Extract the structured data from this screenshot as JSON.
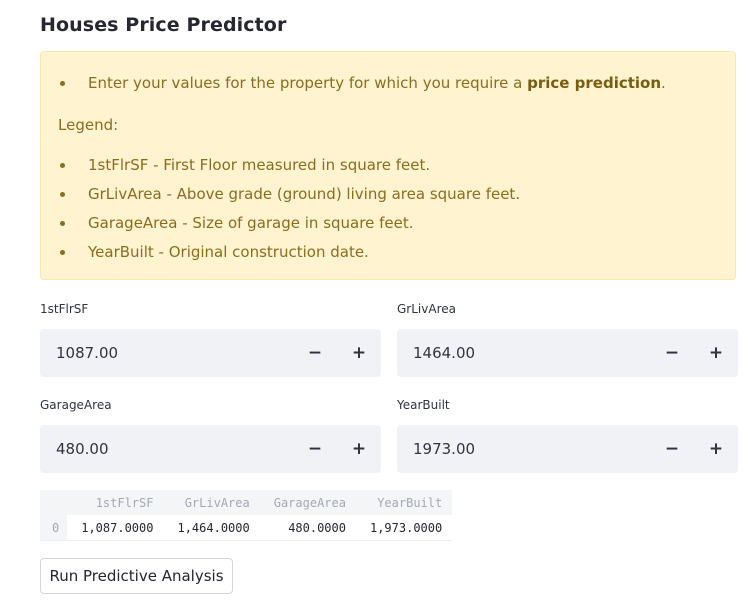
{
  "title": "Houses Price Predictor",
  "info": {
    "intro_prefix": "Enter your values for the property for which you require a ",
    "intro_bold": "price prediction",
    "intro_suffix": ".",
    "legend_label": "Legend:",
    "legend_items": [
      "1stFlrSF - First Floor measured in square feet.",
      "GrLivArea - Above grade (ground) living area square feet.",
      "GarageArea - Size of garage in square feet.",
      "YearBuilt - Original construction date."
    ]
  },
  "inputs": [
    {
      "label": "1stFlrSF",
      "value": "1087.00",
      "minus": "−",
      "plus": "+"
    },
    {
      "label": "GrLivArea",
      "value": "1464.00",
      "minus": "−",
      "plus": "+"
    },
    {
      "label": "GarageArea",
      "value": "480.00",
      "minus": "−",
      "plus": "+"
    },
    {
      "label": "YearBuilt",
      "value": "1973.00",
      "minus": "−",
      "plus": "+"
    }
  ],
  "dataframe": {
    "columns": [
      "",
      "1stFlrSF",
      "GrLivArea",
      "GarageArea",
      "YearBuilt"
    ],
    "rows": [
      [
        "0",
        "1,087.0000",
        "1,464.0000",
        "480.0000",
        "1,973.0000"
      ]
    ]
  },
  "button": {
    "label": "Run Predictive Analysis"
  },
  "colors": {
    "info_bg": "#fff3d0",
    "info_text": "#8b6d1e",
    "input_bg": "#f0f2f6"
  }
}
